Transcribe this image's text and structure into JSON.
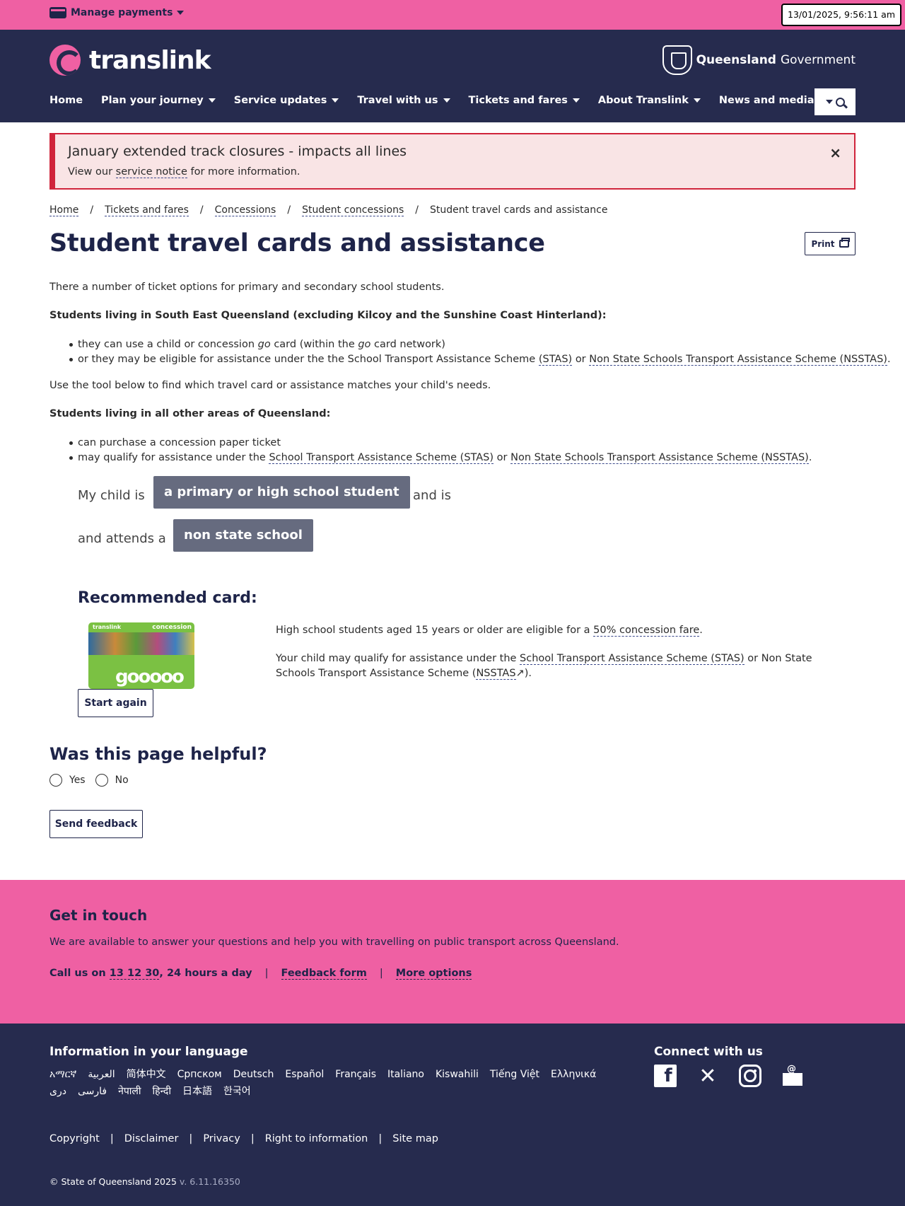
{
  "topbar": {
    "manage_payments": "Manage payments",
    "datetime": "13/01/2025, 9:56:11 am"
  },
  "header": {
    "logo_text": "translink",
    "gov_bold": "Queensland",
    "gov_rest": "Government",
    "nav": [
      "Home",
      "Plan your journey",
      "Service updates",
      "Travel with us",
      "Tickets and fares",
      "About Translink",
      "News and media"
    ]
  },
  "alert": {
    "title": "January extended track closures - impacts all lines",
    "body_prefix": "View our",
    "body_link": "service notice",
    "body_suffix": "for more information.",
    "close": "×"
  },
  "breadcrumb": {
    "items": [
      "Home",
      "Tickets and fares",
      "Concessions",
      "Student concessions"
    ],
    "current": "Student travel cards and assistance",
    "separator": "/"
  },
  "page": {
    "title": "Student travel cards and assistance",
    "print_label": "Print",
    "intro": "There a number of ticket options for primary and secondary school students.",
    "seq_heading": "Students living in South East Queensland (excluding Kilcoy and the Sunshine Coast Hinterland):",
    "seq_bullet1_a": "they can use a child or concession",
    "seq_bullet1_go": "go",
    "seq_bullet1_b": "card (within the",
    "seq_bullet1_c": "card network)",
    "seq_bullet2_a": "or they may be eligible for assistance under the the School Transport Assistance Scheme",
    "seq_bullet2_stas": "(STAS)",
    "seq_bullet2_or": "or",
    "seq_bullet2_nsstas": "Non State Schools Transport Assistance Scheme (NSSTAS)",
    "tool_note": "Use the tool below to find which travel card or assistance matches your child's needs.",
    "other_heading": "Students living in all other areas of Queensland:",
    "other_bullet1": "can purchase a concession paper ticket",
    "other_bullet2_a": "may qualify for assistance under the",
    "other_bullet2_stas": "School Transport Assistance Scheme (STAS)",
    "other_bullet2_or": "or",
    "other_bullet2_nsstas": "Non State Schools Transport Assistance Scheme (NSSTAS)"
  },
  "tool": {
    "my_child_is": "My child is",
    "student_type": "a primary or high school student",
    "and_is": "and is",
    "attends": "and attends a",
    "school_type": "non state school",
    "recommended_title": "Recommended card:",
    "card_brand": "translink",
    "card_type": "concession",
    "card_go": "gooooo",
    "rec_text1_a": "High school students aged 15 years or older are eligible for a",
    "rec_text1_link": "50% concession fare",
    "rec_text2_a": "Your child may qualify for assistance under the",
    "rec_text2_link": "School Transport Assistance Scheme (STAS)",
    "rec_text2_b": "or Non State Schools Transport Assistance Scheme (",
    "rec_text2_link2": "NSSTAS",
    "rec_text2_c": ").",
    "start_again": "Start again"
  },
  "feedback": {
    "question": "Was this page helpful?",
    "yes": "Yes",
    "no": "No",
    "send": "Send feedback"
  },
  "touch": {
    "title": "Get in touch",
    "desc": "We are available to answer your questions and help you with travelling on public transport across Queensland.",
    "call_prefix": "Call us on",
    "phone": "13 12 30",
    "call_suffix": ", 24 hours a day",
    "feedback_form": "Feedback form",
    "more_options": "More options"
  },
  "footer": {
    "lang_title": "Information in your language",
    "languages": [
      "አማርኛ",
      "العربية",
      "简体中文",
      "Српском",
      "Deutsch",
      "Español",
      "Français",
      "Italiano",
      "Kiswahili",
      "Tiếng Việt",
      "Ελληνικά",
      "دری",
      "فارسی",
      "नेपाली",
      "हिन्दी",
      "日本語",
      "한국어"
    ],
    "connect_title": "Connect with us",
    "links": [
      "Copyright",
      "Disclaimer",
      "Privacy",
      "Right to information",
      "Site map"
    ],
    "copyright": "© State of Queensland 2025",
    "version": "v. 6.11.16350"
  }
}
